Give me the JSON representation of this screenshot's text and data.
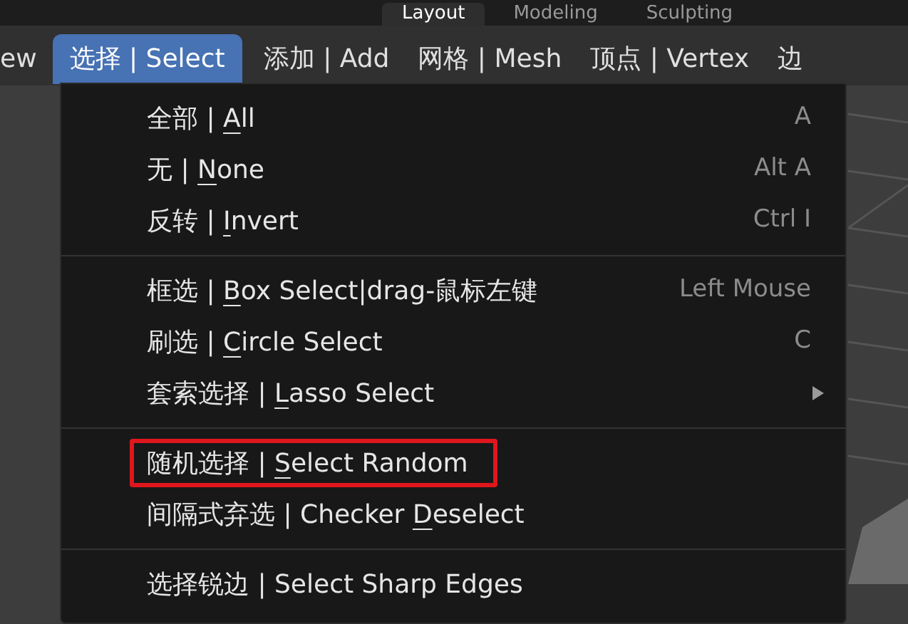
{
  "workspace_tabs": [
    {
      "label": "Layout",
      "selected": true
    },
    {
      "label": "Modeling",
      "selected": false
    },
    {
      "label": "Sculpting",
      "selected": false
    }
  ],
  "menu_bar": [
    {
      "label": "ew",
      "selected": false
    },
    {
      "label": "选择 | Select",
      "selected": true
    },
    {
      "label": "添加 | Add",
      "selected": false
    },
    {
      "label": "网格 | Mesh",
      "selected": false
    },
    {
      "label": "顶点 | Vertex",
      "selected": false
    },
    {
      "label": "边",
      "selected": false
    }
  ],
  "select_menu": {
    "groups": [
      [
        {
          "before": "全部 | ",
          "mnemonic": "A",
          "after": "ll",
          "shortcut": "A",
          "highlighted": false
        },
        {
          "before": "无 | ",
          "mnemonic": "N",
          "after": "one",
          "shortcut": "Alt A",
          "highlighted": false
        },
        {
          "before": "反转 | ",
          "mnemonic": "I",
          "after": "nvert",
          "shortcut": "Ctrl I",
          "highlighted": false
        }
      ],
      [
        {
          "before": "框选 | ",
          "mnemonic": "B",
          "after": "ox Select|drag-鼠标左键",
          "shortcut": "Left Mouse",
          "highlighted": false
        },
        {
          "before": "刷选 | ",
          "mnemonic": "C",
          "after": "ircle Select",
          "shortcut": "C",
          "highlighted": false
        },
        {
          "before": "套索选择 | ",
          "mnemonic": "L",
          "after": "asso Select",
          "submenu": true,
          "highlighted": false
        }
      ],
      [
        {
          "before": "随机选择 | ",
          "mnemonic": "S",
          "after": "elect Random",
          "highlighted": true
        },
        {
          "before": "间隔式弃选 | Checker ",
          "mnemonic": "D",
          "after": "eselect",
          "highlighted": false
        }
      ],
      [
        {
          "before": "选择锐边 | Select Sharp Edges",
          "highlighted": false
        }
      ]
    ]
  }
}
